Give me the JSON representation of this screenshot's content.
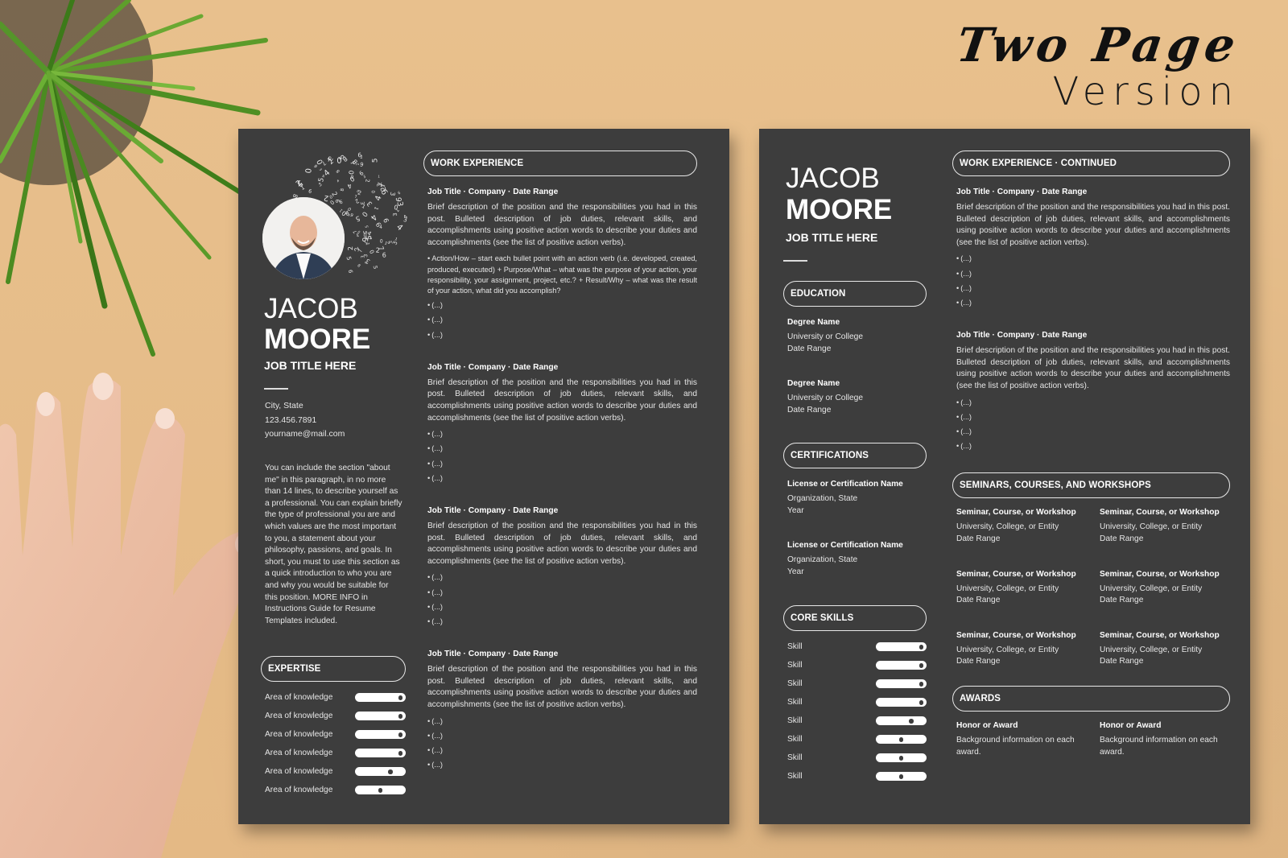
{
  "headline": {
    "line1": "Two Page",
    "line2": "Version"
  },
  "colors": {
    "background": "#e6bd8a",
    "page": "#3d3d3d",
    "text": "#ffffff",
    "muted_text": "#e6e6e6"
  },
  "page1": {
    "name_first": "JACOB",
    "name_last": "MOORE",
    "job_title": "JOB TITLE HERE",
    "contact": {
      "location": "City, State",
      "phone": "123.456.7891",
      "email": "yourname@mail.com"
    },
    "about": "You can include the section \"about me\" in this paragraph, in no more than 14 lines, to describe yourself as a professional. You can explain briefly the type of professional you are and which values are the most important to you, a statement about your philosophy, passions, and goals. In short, you must to use this section as a quick introduction to who you are and why you would be suitable for this position. MORE INFO in Instructions Guide for Resume Templates included.",
    "expertise": {
      "heading": "EXPERTISE",
      "items": [
        {
          "label": "Area of knowledge",
          "level": 0.9
        },
        {
          "label": "Area of knowledge",
          "level": 0.9
        },
        {
          "label": "Area of knowledge",
          "level": 0.9
        },
        {
          "label": "Area of knowledge",
          "level": 0.9
        },
        {
          "label": "Area of knowledge",
          "level": 0.7
        },
        {
          "label": "Area of knowledge",
          "level": 0.5
        }
      ]
    },
    "work": {
      "heading": "WORK EXPERIENCE",
      "jobs": [
        {
          "title": "Job Title · Company · Date Range",
          "desc": "Brief description of the position and the responsibilities you had in this post. Bulleted description of job duties, relevant skills, and accomplishments using positive action words to describe your duties and accomplishments (see the list of positive action verbs).",
          "bullets": [
            "Action/How – start each bullet point with an action verb (i.e. developed, created, produced, executed) + Purpose/What – what was the purpose of your action, your responsibility, your assignment, project, etc.? + Result/Why – what was the result of your action, what did you accomplish?",
            "(...)",
            "(...)",
            "(...)"
          ]
        },
        {
          "title": "Job Title · Company · Date Range",
          "desc": "Brief description of the position and the responsibilities you had in this post. Bulleted description of job duties, relevant skills, and accomplishments using positive action words to describe your duties and accomplishments (see the list of positive action verbs).",
          "bullets": [
            "(...)",
            "(...)",
            "(...)",
            "(...)"
          ]
        },
        {
          "title": "Job Title · Company · Date Range",
          "desc": "Brief description of the position and the responsibilities you had in this post. Bulleted description of job duties, relevant skills, and accomplishments using positive action words to describe your duties and accomplishments (see the list of positive action verbs).",
          "bullets": [
            "(...)",
            "(...)",
            "(...)",
            "(...)"
          ]
        },
        {
          "title": "Job Title · Company · Date Range",
          "desc": "Brief description of the position and the responsibilities you had in this post. Bulleted description of job duties, relevant skills, and accomplishments using positive action words to describe your duties and accomplishments (see the list of positive action verbs).",
          "bullets": [
            "(...)",
            "(...)",
            "(...)",
            "(...)"
          ]
        }
      ]
    }
  },
  "page2": {
    "name_first": "JACOB",
    "name_last": "MOORE",
    "job_title": "JOB TITLE HERE",
    "education": {
      "heading": "EDUCATION",
      "items": [
        {
          "title": "Degree Name",
          "line1": "University or College",
          "line2": "Date Range"
        },
        {
          "title": "Degree Name",
          "line1": "University or College",
          "line2": "Date Range"
        }
      ]
    },
    "certifications": {
      "heading": "CERTIFICATIONS",
      "items": [
        {
          "title": "License or Certification Name",
          "line1": "Organization, State",
          "line2": "Year"
        },
        {
          "title": "License or Certification Name",
          "line1": "Organization, State",
          "line2": "Year"
        }
      ]
    },
    "skills": {
      "heading": "CORE SKILLS",
      "items": [
        {
          "label": "Skill",
          "level": 0.9
        },
        {
          "label": "Skill",
          "level": 0.9
        },
        {
          "label": "Skill",
          "level": 0.9
        },
        {
          "label": "Skill",
          "level": 0.9
        },
        {
          "label": "Skill",
          "level": 0.7
        },
        {
          "label": "Skill",
          "level": 0.5
        },
        {
          "label": "Skill",
          "level": 0.5
        },
        {
          "label": "Skill",
          "level": 0.5
        }
      ]
    },
    "work": {
      "heading": "WORK EXPERIENCE · CONTINUED",
      "jobs": [
        {
          "title": "Job Title · Company · Date Range",
          "desc": "Brief description of the position and the responsibilities you had in this post. Bulleted description of job duties, relevant skills, and accomplishments using positive action words to describe your duties and accomplishments (see the list of positive action verbs).",
          "bullets": [
            "(...)",
            "(...)",
            "(...)",
            "(...)"
          ]
        },
        {
          "title": "Job Title · Company · Date Range",
          "desc": "Brief description of the position and the responsibilities you had in this post. Bulleted description of job duties, relevant skills, and accomplishments using positive action words to describe your duties and accomplishments (see the list of positive action verbs).",
          "bullets": [
            "(...)",
            "(...)",
            "(...)",
            "(...)"
          ]
        }
      ]
    },
    "seminars": {
      "heading": "SEMINARS, COURSES, AND WORKSHOPS",
      "items": [
        {
          "title": "Seminar, Course, or Workshop",
          "line1": "University, College, or Entity",
          "line2": "Date Range"
        },
        {
          "title": "Seminar, Course, or Workshop",
          "line1": "University, College, or Entity",
          "line2": "Date Range"
        },
        {
          "title": "Seminar, Course, or Workshop",
          "line1": "University, College, or Entity",
          "line2": "Date Range"
        },
        {
          "title": "Seminar, Course, or Workshop",
          "line1": "University, College, or Entity",
          "line2": "Date Range"
        },
        {
          "title": "Seminar, Course, or Workshop",
          "line1": "University, College, or Entity",
          "line2": "Date Range"
        },
        {
          "title": "Seminar, Course, or Workshop",
          "line1": "University, College, or Entity",
          "line2": "Date Range"
        }
      ]
    },
    "awards": {
      "heading": "AWARDS",
      "items": [
        {
          "title": "Honor or Award",
          "desc": "Background information on each award."
        },
        {
          "title": "Honor or Award",
          "desc": "Background information on each award."
        }
      ]
    }
  }
}
